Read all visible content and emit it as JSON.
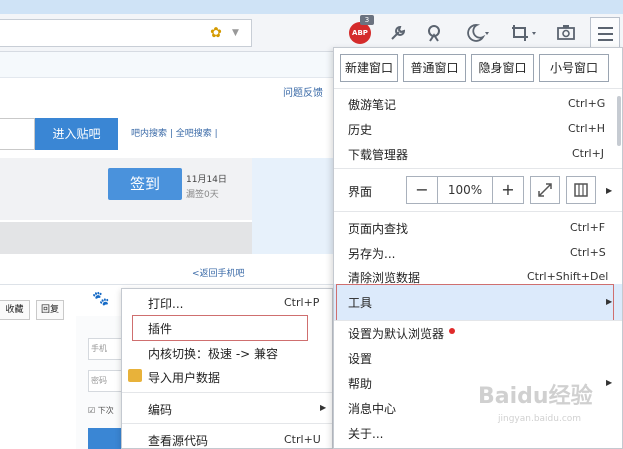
{
  "toolbar": {
    "abp_label": "ABP",
    "abp_badge": "3",
    "icons": [
      "bee-icon",
      "wrench-icon",
      "user-icon",
      "moon-icon",
      "crop-icon",
      "camera-icon",
      "hamburger-menu-icon"
    ]
  },
  "page": {
    "feedback_link": "问题反馈",
    "enter_bar_button": "进入贴吧",
    "search_links": "吧内搜索 | 全吧搜索 |",
    "signin_button": "签到",
    "sign_date": "11月14日",
    "sign_days": "漏签0天",
    "back_link": "<返回手机吧",
    "collect_button": "收藏",
    "reply_button": "回复",
    "phone_placeholder": "手机",
    "password_placeholder": "密码",
    "remember_label": "下次"
  },
  "context_menu": {
    "items": [
      {
        "label": "打印...",
        "shortcut": "Ctrl+P"
      },
      {
        "label": "插件",
        "shortcut": ""
      },
      {
        "label": "内核切换：极速 -> 兼容",
        "shortcut": ""
      },
      {
        "label": "导入用户数据",
        "shortcut": ""
      },
      {
        "label": "编码",
        "shortcut": ""
      },
      {
        "label": "查看源代码",
        "shortcut": "Ctrl+U"
      }
    ]
  },
  "main_menu": {
    "window_buttons": [
      "新建窗口",
      "普通窗口",
      "隐身窗口",
      "小号窗口"
    ],
    "items_top": [
      {
        "label": "傲游笔记",
        "shortcut": "Ctrl+G"
      },
      {
        "label": "历史",
        "shortcut": "Ctrl+H"
      },
      {
        "label": "下载管理器",
        "shortcut": "Ctrl+J"
      }
    ],
    "zoom": {
      "label": "界面",
      "minus": "−",
      "value": "100%",
      "plus": "+"
    },
    "items_mid": [
      {
        "label": "页面内查找",
        "shortcut": "Ctrl+F"
      },
      {
        "label": "另存为...",
        "shortcut": "Ctrl+S"
      },
      {
        "label": "清除浏览数据",
        "shortcut": "Ctrl+Shift+Del"
      }
    ],
    "tools_label": "工具",
    "items_bottom": [
      {
        "label": "设置为默认浏览器"
      },
      {
        "label": "设置"
      },
      {
        "label": "帮助"
      },
      {
        "label": "消息中心"
      },
      {
        "label": "关于..."
      }
    ]
  },
  "watermark": {
    "text": "Baidu经验",
    "sub": "jingyan.baidu.com"
  },
  "colors": {
    "accent": "#3a86d4",
    "highlight": "#dceafb",
    "annotation_red": "#cf6f6f"
  }
}
